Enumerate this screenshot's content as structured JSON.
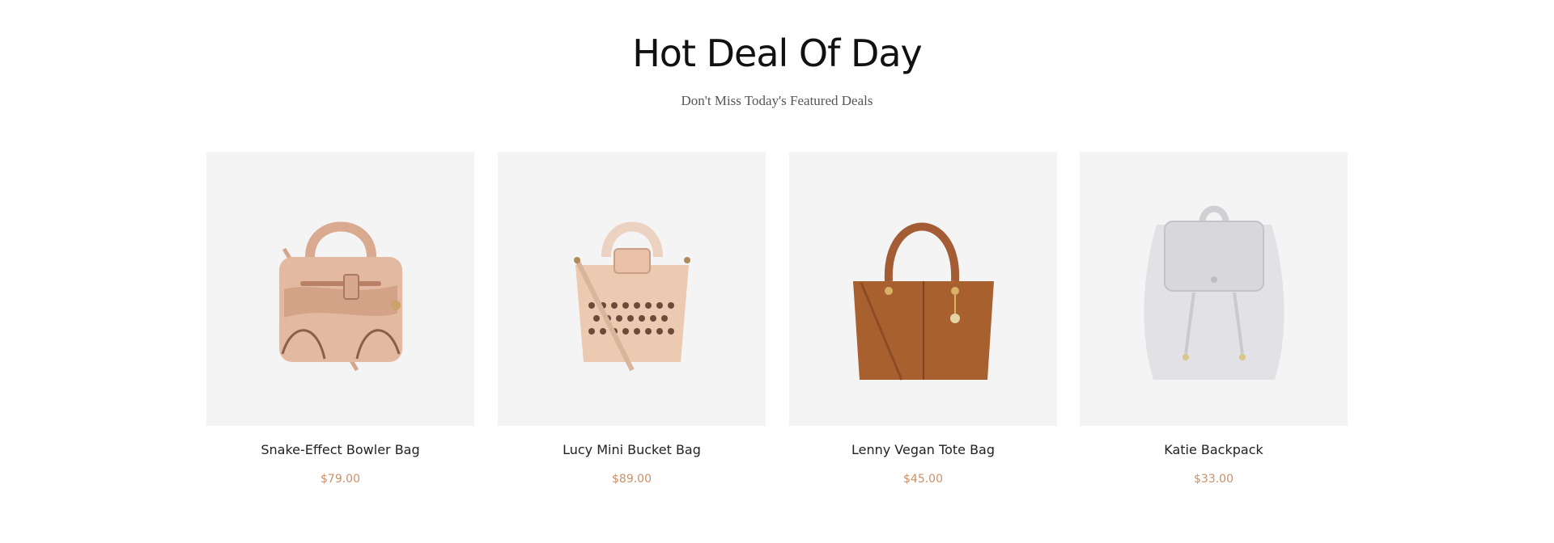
{
  "section": {
    "title": "Hot Deal Of Day",
    "subtitle": "Don't Miss Today's Featured Deals"
  },
  "products": [
    {
      "name": "Snake-Effect Bowler Bag",
      "price": "$79.00",
      "image_icon": "bowler-bag-icon"
    },
    {
      "name": "Lucy Mini Bucket Bag",
      "price": "$89.00",
      "image_icon": "bucket-bag-icon"
    },
    {
      "name": "Lenny Vegan Tote Bag",
      "price": "$45.00",
      "image_icon": "tote-bag-icon"
    },
    {
      "name": "Katie Backpack",
      "price": "$33.00",
      "image_icon": "backpack-icon"
    }
  ],
  "colors": {
    "price": "#c9906a",
    "card_background": "#f4f4f4"
  }
}
